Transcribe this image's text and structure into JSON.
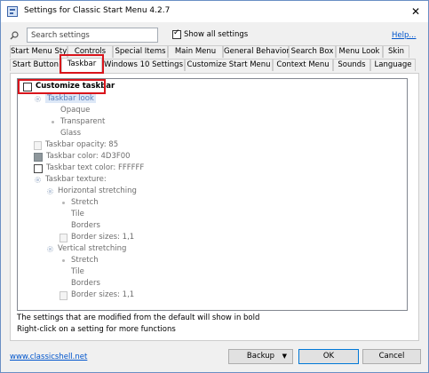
{
  "window": {
    "title": "Settings for Classic Start Menu 4.2.7",
    "close_glyph": "✕"
  },
  "toolbar": {
    "search_placeholder": "Search settings",
    "show_all_label": "Show all settings",
    "show_all_checked": true,
    "help_label": "Help..."
  },
  "tabs": {
    "row1": [
      "Start Menu Style",
      "Controls",
      "Special Items",
      "Main Menu",
      "General Behavior",
      "Search Box",
      "Menu Look",
      "Skin"
    ],
    "row2": [
      "Start Button",
      "Taskbar",
      "Windows 10 Settings",
      "Customize Start Menu",
      "Context Menu",
      "Sounds",
      "Language"
    ],
    "active": "Taskbar"
  },
  "tree": {
    "root_label": "Customize taskbar",
    "items": [
      {
        "label": "Taskbar look",
        "icon": "setting-icon"
      },
      {
        "label": "Opaque",
        "icon": "none"
      },
      {
        "label": "Transparent",
        "icon": "radio-dot-icon"
      },
      {
        "label": "Glass",
        "icon": "none"
      },
      {
        "label": "Taskbar opacity: 85",
        "icon": "number-icon"
      },
      {
        "label": "Taskbar color: 4D3F00",
        "icon": "color-swatch-icon",
        "color": "#8e979c"
      },
      {
        "label": "Taskbar text color: FFFFFF",
        "icon": "color-swatch-icon",
        "color": "#ffffff"
      },
      {
        "label": "Taskbar texture:",
        "icon": "setting-icon"
      },
      {
        "label": "Horizontal stretching",
        "icon": "setting-icon"
      },
      {
        "label": "Stretch",
        "icon": "radio-dot-icon"
      },
      {
        "label": "Tile",
        "icon": "none"
      },
      {
        "label": "Borders",
        "icon": "none"
      },
      {
        "label": "Border sizes: 1,1",
        "icon": "number-icon"
      },
      {
        "label": "Vertical stretching",
        "icon": "setting-icon"
      },
      {
        "label": "Stretch",
        "icon": "radio-dot-icon"
      },
      {
        "label": "Tile",
        "icon": "none"
      },
      {
        "label": "Borders",
        "icon": "none"
      },
      {
        "label": "Border sizes: 1,1",
        "icon": "number-icon"
      }
    ]
  },
  "hints": [
    "The settings that are modified from the default will show in bold",
    "Right-click on a setting for more functions"
  ],
  "footer": {
    "website": "www.classicshell.net",
    "backup_label": "Backup",
    "backup_caret": "▼",
    "ok_label": "OK",
    "cancel_label": "Cancel"
  },
  "colors": {
    "highlight_red": "#d9141b",
    "link_blue": "#0055cc",
    "selection_bg": "#dde8f7"
  }
}
